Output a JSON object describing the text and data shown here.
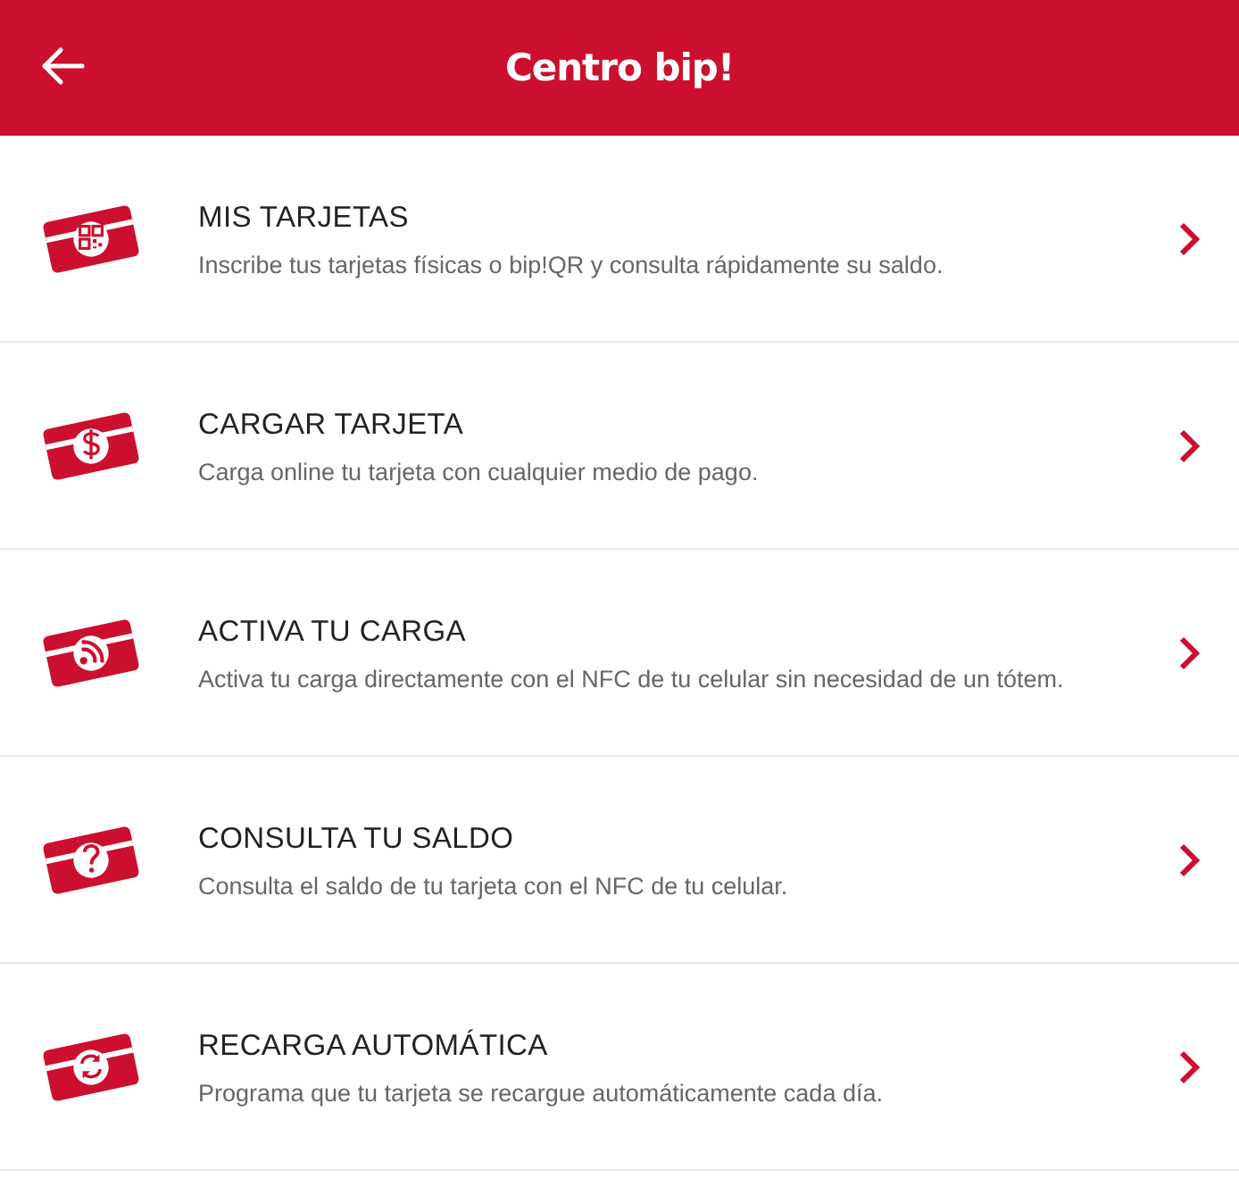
{
  "header": {
    "title": "Centro bip!"
  },
  "items": [
    {
      "kind": "qr",
      "title": "MIS TARJETAS",
      "description": "Inscribe tus tarjetas físicas o bip!QR y consulta rápidamente su saldo."
    },
    {
      "kind": "dollar",
      "title": "CARGAR TARJETA",
      "description": "Carga online tu tarjeta con cualquier medio de pago."
    },
    {
      "kind": "wireless",
      "title": "ACTIVA TU CARGA",
      "description": "Activa tu carga directamente con el NFC de tu celular sin necesidad de un tótem."
    },
    {
      "kind": "question",
      "title": "CONSULTA TU SALDO",
      "description": "Consulta el saldo de tu tarjeta con el NFC de tu celular."
    },
    {
      "kind": "refresh",
      "title": "RECARGA AUTOMÁTICA",
      "description": "Programa que tu tarjeta se recargue automáticamente cada día."
    }
  ]
}
